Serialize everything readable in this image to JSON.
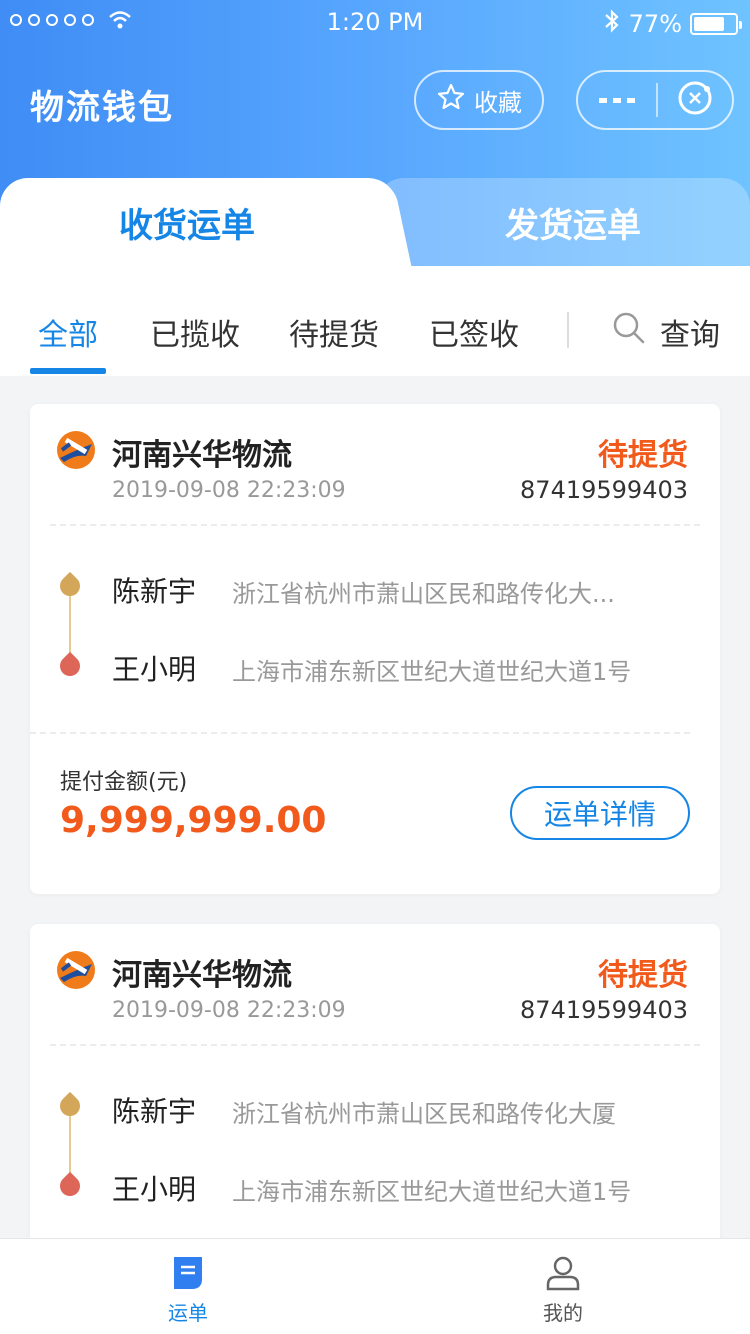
{
  "status_bar": {
    "time": "1:20 PM",
    "battery": "77%"
  },
  "header": {
    "title": "物流钱包",
    "favorite_label": "收藏"
  },
  "main_tabs": [
    {
      "label": "收货运单",
      "active": true
    },
    {
      "label": "发货运单",
      "active": false
    }
  ],
  "filters": {
    "items": [
      {
        "label": "全部",
        "active": true
      },
      {
        "label": "已揽收",
        "active": false
      },
      {
        "label": "待提货",
        "active": false
      },
      {
        "label": "已签收",
        "active": false
      }
    ],
    "query_label": "查询"
  },
  "orders": [
    {
      "company": "河南兴华物流",
      "status": "待提货",
      "datetime": "2019-09-08 22:23:09",
      "order_no": "87419599403",
      "sender_name": "陈新宇",
      "sender_address": "浙江省杭州市萧山区民和路传化大...",
      "receiver_name": "王小明",
      "receiver_address": "上海市浦东新区世纪大道世纪大道1号",
      "amount_label": "提付金额(元)",
      "amount": "9,999,999.00",
      "detail_button": "运单详情"
    },
    {
      "company": "河南兴华物流",
      "status": "待提货",
      "datetime": "2019-09-08 22:23:09",
      "order_no": "87419599403",
      "sender_name": "陈新宇",
      "sender_address": "浙江省杭州市萧山区民和路传化大厦",
      "receiver_name": "王小明",
      "receiver_address": "上海市浦东新区世纪大道世纪大道1号"
    }
  ],
  "bottom_nav": [
    {
      "label": "运单",
      "icon": "document-icon",
      "active": true
    },
    {
      "label": "我的",
      "icon": "user-icon",
      "active": false
    }
  ],
  "colors": {
    "accent": "#1686e6",
    "status_orange": "#f25a1c",
    "header_gradient_start": "#3f8df5",
    "header_gradient_end": "#6fc3ff"
  }
}
